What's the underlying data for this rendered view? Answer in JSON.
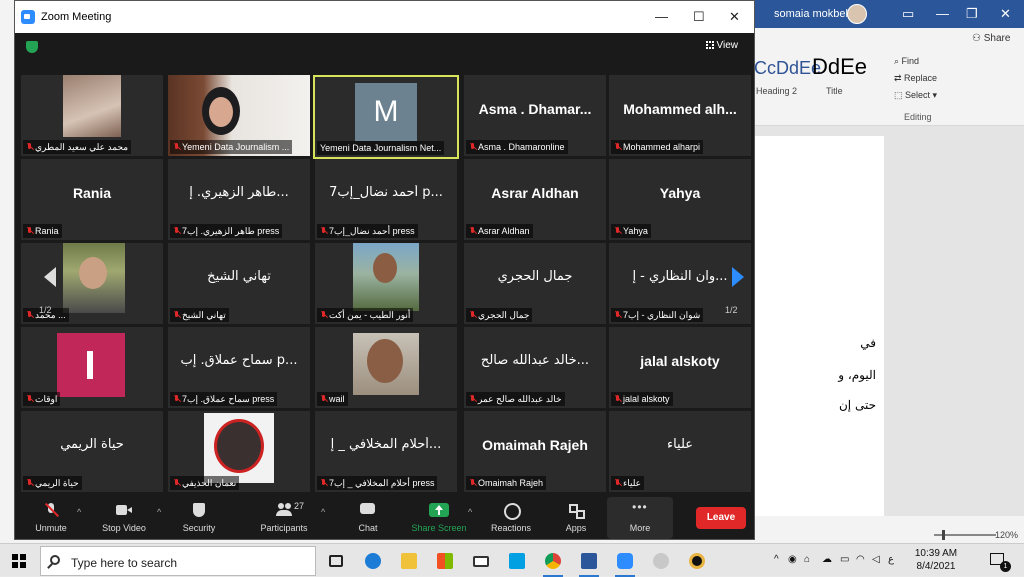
{
  "word": {
    "user": "somaia mokbel",
    "share": "Share",
    "styles": [
      {
        "sample": "CcDdEe",
        "label": "Heading 2",
        "color": "#2f5496"
      },
      {
        "sample": "DdEe",
        "label": "Title",
        "color": "#000000"
      }
    ],
    "editing": {
      "find": "Find",
      "replace": "Replace",
      "select": "Select",
      "group": "Editing"
    },
    "doc_lines": [
      "في",
      "اليوم، و",
      "حتى إن"
    ],
    "zoom": "120%"
  },
  "zoom": {
    "window_title": "Zoom Meeting",
    "view_label": "View",
    "page_left": "1/2",
    "page_right": "1/2",
    "tiles": [
      {
        "label": "محمد علي سعيد المطري",
        "display": "",
        "kind": "video"
      },
      {
        "label": "Yemeni Data Journalism ...",
        "display": "",
        "kind": "video"
      },
      {
        "label": "Yemeni Data Journalism Net...",
        "display": "M",
        "kind": "avatar-m"
      },
      {
        "label": "Asma . Dhamaronline",
        "display": "Asma . Dhamar...",
        "kind": "text"
      },
      {
        "label": "Mohammed alharpi",
        "display": "Mohammed alh...",
        "kind": "text"
      },
      {
        "label": "Rania",
        "display": "Rania",
        "kind": "text"
      },
      {
        "label": "7طاهر الزهيري. إب press",
        "display": "طاهر الزهيري. إ...",
        "kind": "text-ar"
      },
      {
        "label": "7أحمد نضال_إب press",
        "display": "7أحمد نضال_إب p...",
        "kind": "text-ar"
      },
      {
        "label": "Asrar Aldhan",
        "display": "Asrar Aldhan",
        "kind": "text"
      },
      {
        "label": "Yahya",
        "display": "Yahya",
        "kind": "text"
      },
      {
        "label": "محمد ... ",
        "display": "",
        "kind": "video"
      },
      {
        "label": "تهاني الشيخ",
        "display": "تهاني الشيخ",
        "kind": "text-ar"
      },
      {
        "label": "أنور الطيب - يمن أكت",
        "display": "",
        "kind": "video"
      },
      {
        "label": "جمال الحجري",
        "display": "جمال الحجري",
        "kind": "text-ar"
      },
      {
        "label": "7شوان النظاري - إب",
        "display": "وان النظاري - إ...",
        "kind": "text-ar"
      },
      {
        "label": "اوقات",
        "display": "",
        "kind": "avatar-i"
      },
      {
        "label": "7سماح عملاق. إب press",
        "display": "سماح عملاق. إب p...",
        "kind": "text-ar"
      },
      {
        "label": "wail",
        "display": "",
        "kind": "video"
      },
      {
        "label": "خالد عبدالله صالح عمر",
        "display": "خالد عبدالله صالح...",
        "kind": "text-ar"
      },
      {
        "label": "jalal alskoty",
        "display": "jalal alskoty",
        "kind": "text"
      },
      {
        "label": "حياة الريمي",
        "display": "حياة الريمي",
        "kind": "text-ar"
      },
      {
        "label": "نعمان الحذيفي",
        "display": "",
        "kind": "video"
      },
      {
        "label": "7أحلام المخلافي _ إب press",
        "display": "أحلام المخلافي _ إ...",
        "kind": "text-ar"
      },
      {
        "label": "Omaimah Rajeh",
        "display": "Omaimah Rajeh",
        "kind": "text"
      },
      {
        "label": "علياء",
        "display": "علياء",
        "kind": "text-ar"
      }
    ],
    "toolbar": {
      "unmute": "Unmute",
      "stop_video": "Stop Video",
      "security": "Security",
      "participants": "Participants",
      "participants_count": "27",
      "chat": "Chat",
      "share_screen": "Share Screen",
      "reactions": "Reactions",
      "apps": "Apps",
      "more": "More",
      "leave": "Leave"
    }
  },
  "taskbar": {
    "search_placeholder": "Type here to search",
    "time": "10:39 AM",
    "date": "8/4/2021",
    "language": "ع",
    "notification_count": "1"
  },
  "colors": {
    "accent": "#2d8cff",
    "active_speaker": "#d7e35a",
    "leave": "#e02828",
    "word_blue": "#2b579a"
  }
}
